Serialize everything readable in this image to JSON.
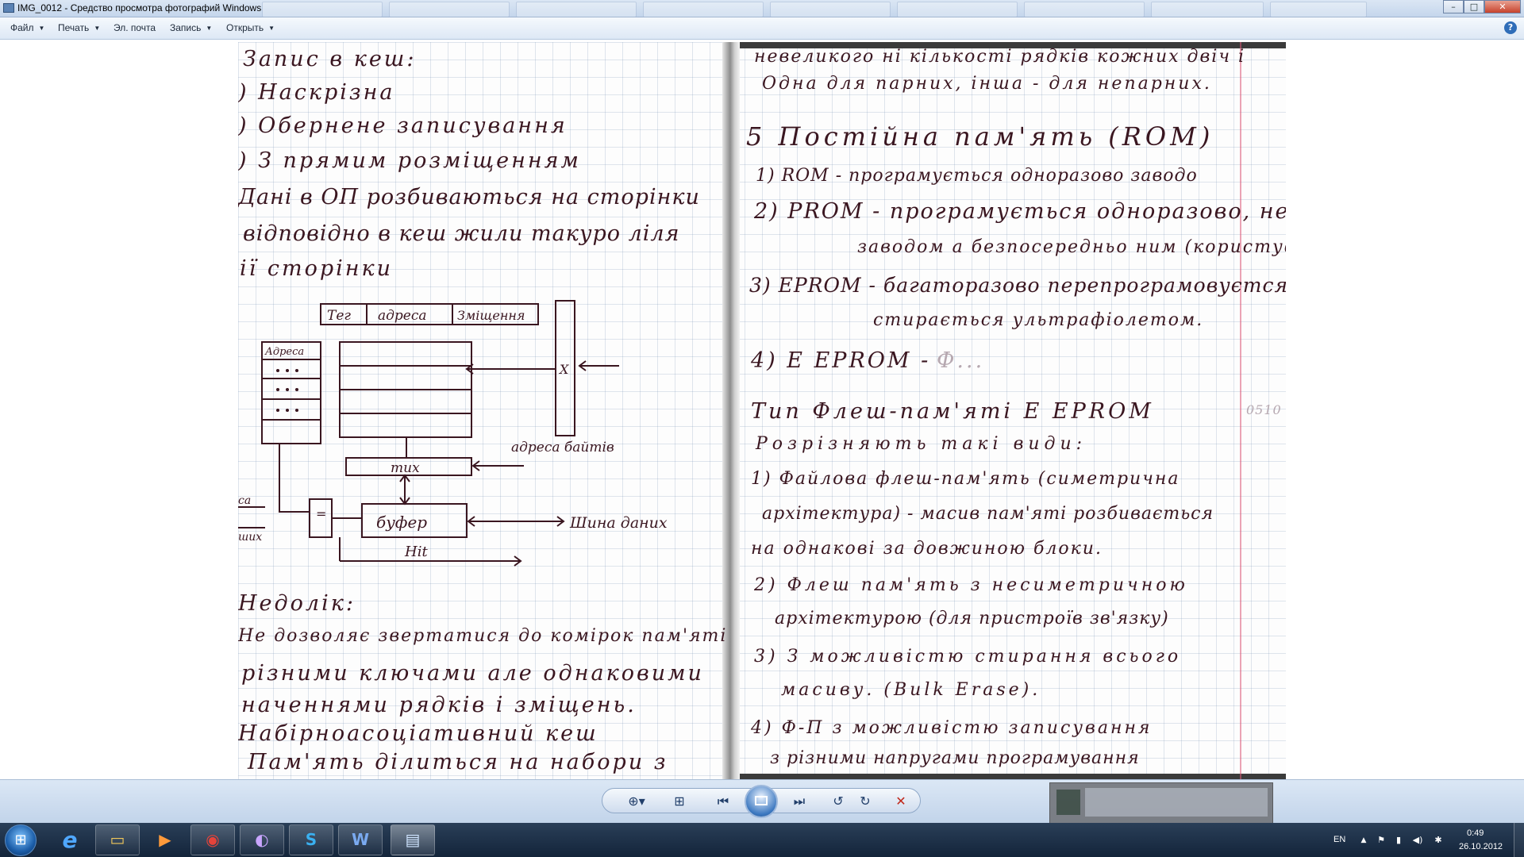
{
  "window": {
    "title": "IMG_0012 - Средство просмотра фотографий Windows",
    "buttons": {
      "minimize": "–",
      "maximize": "□",
      "close": "✕"
    }
  },
  "menu": {
    "items": [
      {
        "label": "Файл"
      },
      {
        "label": "Печать"
      },
      {
        "label": "Эл. почта"
      },
      {
        "label": "Запись"
      },
      {
        "label": "Открыть"
      }
    ],
    "help": "?"
  },
  "photo": {
    "left_page": [
      "Запис в кеш:",
      ") Наскрізна",
      ") Обернене записування",
      ") З прямим розміщенням",
      "Дані в ОП розбиваються на сторінки",
      "відповідно в кеш жили такуро ліля",
      "ії сторінки",
      "Недолік:",
      "Не дозволяє звертатися до комірок пам'яті",
      "різними ключами але однаковими",
      "наченнями рядків і зміщень.",
      "Набірноасоціативний кеш",
      "Пам'ять ділиться на набори з"
    ],
    "diagram": {
      "tag": "Тег",
      "address": "адреса",
      "offset": "Зміщення",
      "addresses": "Адреса",
      "mux_right": "X",
      "byte_addr": "адреса байтів",
      "mux": "mux",
      "buffer": "буфер",
      "data_bus": "Шина даних",
      "hit": "Hit",
      "cmp": "=",
      "left_a": "са",
      "left_b": "ших"
    },
    "right_page": [
      "невеликого ні кількості рядків кожних двіч і",
      "Одна для парних, інша - для непарних.",
      "5 Постійна пам'ять (ROM)",
      "1) ROM - програмується одноразово заводо",
      "2) PROM - програмується одноразово, не",
      "заводом а безпосередньо ним (користув",
      "3) EPROM - багаторазово перепрограмовуєтся,",
      "стирається ультрафіолетом.",
      "4) E EPROM -",
      "Тип Флеш-пам'яті E EPROM",
      "Розрізняють такі види:",
      "1) Файлова флеш-пам'ять (симетрична",
      "архітектура) - масив пам'яті розбивається",
      "на однакові за довжиною блоки.",
      "2) Флеш пам'ять з несиметричною",
      "архітектурою (для пристроїв зв'язку)",
      "3) З можливістю стирання всього",
      "масиву. (Bulk Erase).",
      "4) Ф-П з можливістю записування",
      "з різними напругами програмування"
    ],
    "faded": "Ф...",
    "page_number": "0510"
  },
  "controls": {
    "zoom": "⊕▾",
    "fit": "⊞",
    "prev": "⏮",
    "next": "⏭",
    "rotate_ccw": "↺",
    "rotate_cw": "↻",
    "delete": "✕",
    "icons": [
      "zoom-icon",
      "fit-to-window-icon",
      "previous-icon",
      "slideshow-icon",
      "next-icon",
      "rotate-left-icon",
      "rotate-right-icon",
      "delete-icon"
    ]
  },
  "taskbar": {
    "start": "⊞",
    "apps": [
      {
        "name": "internet-explorer",
        "glyph": "e"
      },
      {
        "name": "file-explorer",
        "glyph": "▭"
      },
      {
        "name": "media-player",
        "glyph": "▶"
      },
      {
        "name": "chrome",
        "glyph": "◉"
      },
      {
        "name": "torrent",
        "glyph": "◐"
      },
      {
        "name": "skype",
        "glyph": "S"
      },
      {
        "name": "word",
        "glyph": "W"
      },
      {
        "name": "photo-viewer",
        "glyph": "▤"
      }
    ],
    "lang": "EN",
    "tray_arrow": "▲",
    "tray_icons": [
      "⚑",
      "▮",
      "◀)",
      "✱"
    ],
    "time": "0:49",
    "date": "26.10.2012"
  },
  "colors": {
    "ink": "#3a1620",
    "margin_line": "#dc5a78",
    "taskbar": "#13243a"
  }
}
